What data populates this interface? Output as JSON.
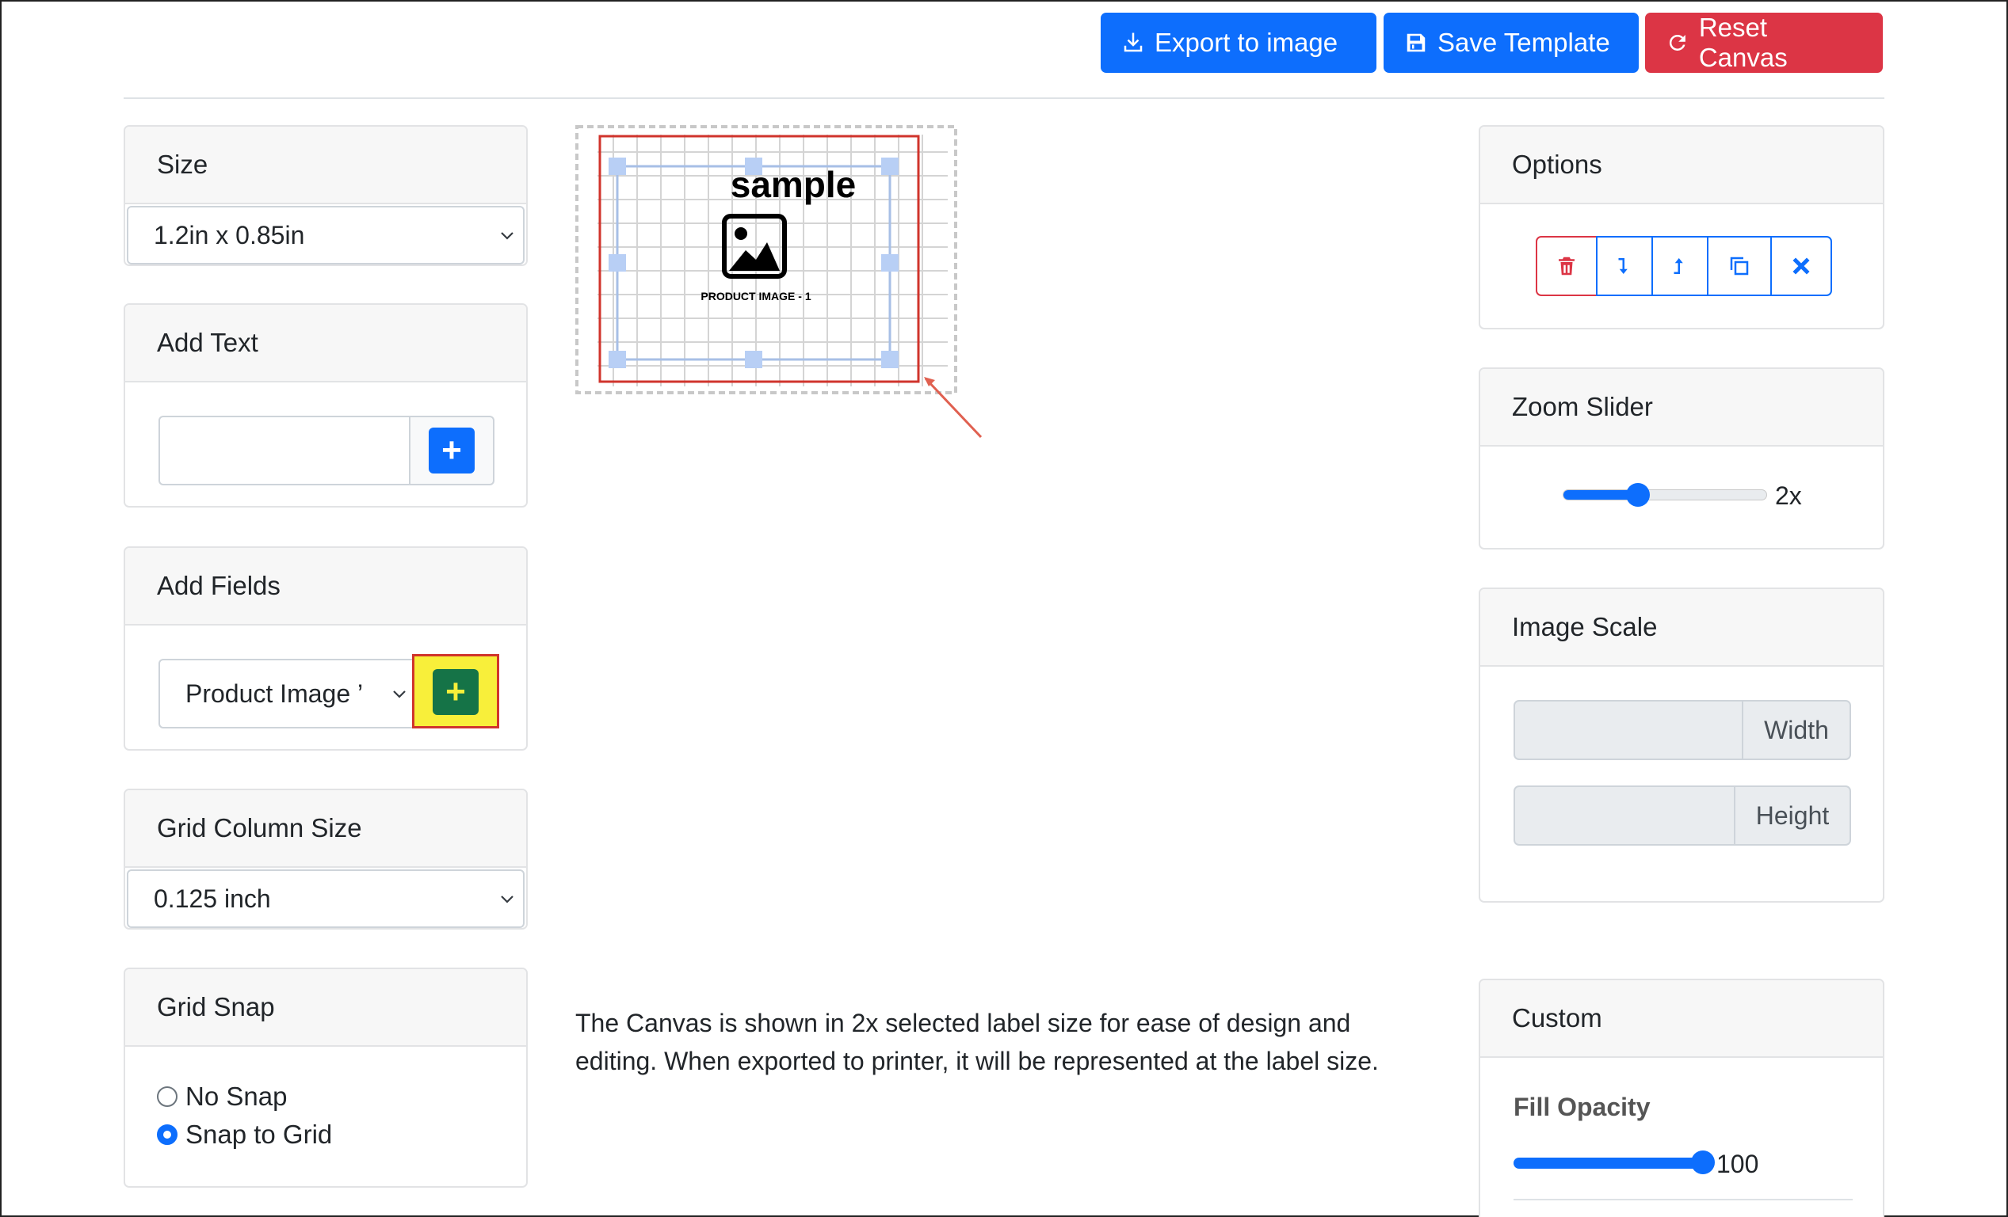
{
  "toolbar": {
    "export_label": "Export to image",
    "save_label": "Save Template",
    "reset_label": "Reset Canvas"
  },
  "size": {
    "title": "Size",
    "selected": "1.2in x 0.85in"
  },
  "add_text": {
    "title": "Add Text",
    "value": "",
    "button_label": "+"
  },
  "add_fields": {
    "title": "Add Fields",
    "selected": "Product Image ’",
    "button_label": "+"
  },
  "grid_column": {
    "title": "Grid Column Size",
    "selected": "0.125 inch"
  },
  "grid_snap": {
    "title": "Grid Snap",
    "options": [
      "No Snap",
      "Snap to Grid"
    ],
    "selected": "Snap to Grid"
  },
  "canvas": {
    "sample_text": "sample",
    "image_caption": "PRODUCT IMAGE - 1"
  },
  "description": "The Canvas is shown in 2x selected label size for ease of design and editing. When exported to printer, it will be represented at the label size.",
  "options": {
    "title": "Options",
    "buttons": [
      "delete-icon",
      "send-backward-icon",
      "bring-forward-icon",
      "duplicate-icon",
      "close-icon"
    ]
  },
  "zoom": {
    "title": "Zoom Slider",
    "value_label": "2x",
    "level": 0.35
  },
  "image_scale": {
    "title": "Image Scale",
    "width_label": "Width",
    "height_label": "Height"
  },
  "custom": {
    "title": "Custom",
    "fill_opacity_label": "Fill Opacity",
    "fill_opacity_value": "100",
    "fill_opacity_level": 1.0
  },
  "colors": {
    "primary": "#0d6efd",
    "danger": "#dc3545",
    "highlight": "#f8ef3a",
    "success": "#157347"
  }
}
